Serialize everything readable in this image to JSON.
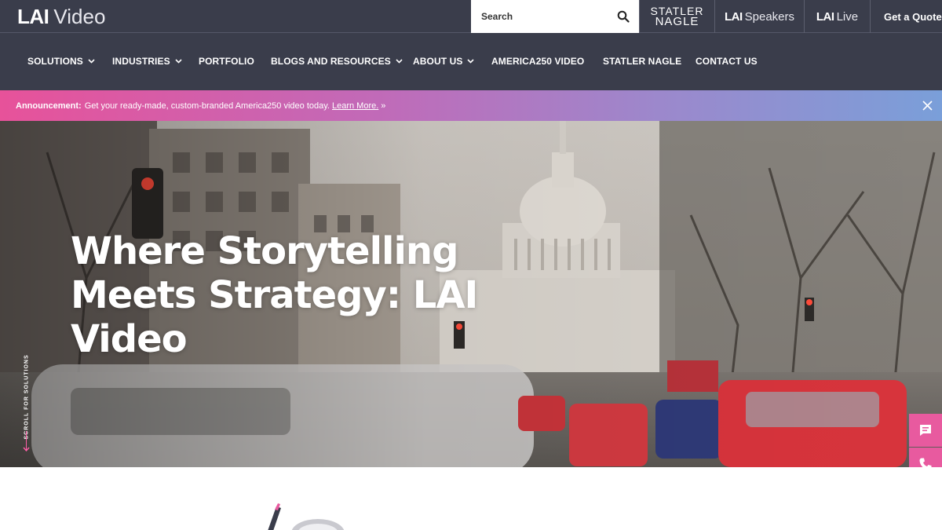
{
  "brand": {
    "logo_bold": "LAI",
    "logo_light": "Video"
  },
  "search": {
    "placeholder": "Search"
  },
  "utility_links": {
    "statler_line1": "STATLER",
    "statler_line2": "NAGLE",
    "speakers_bold": "LAI",
    "speakers_light": "Speakers",
    "live_bold": "LAI",
    "live_light": "Live",
    "quote": "Get a Quote"
  },
  "nav": {
    "items": [
      {
        "label": "SOLUTIONS",
        "has_dropdown": true
      },
      {
        "label": "INDUSTRIES",
        "has_dropdown": true
      },
      {
        "label": "PORTFOLIO",
        "has_dropdown": false
      },
      {
        "label": "BLOGS AND RESOURCES",
        "has_dropdown": true
      },
      {
        "label": "ABOUT US",
        "has_dropdown": true
      },
      {
        "label": "AMERICA250 VIDEO",
        "has_dropdown": false
      },
      {
        "label": "STATLER NAGLE",
        "has_dropdown": false
      },
      {
        "label": "CONTACT US",
        "has_dropdown": false
      }
    ]
  },
  "announcement": {
    "label": "Announcement:",
    "text": "Get your ready-made, custom-branded America250 video today.",
    "link": "Learn More.",
    "arrow": "»"
  },
  "hero": {
    "title": "Where Storytelling Meets Strategy: LAI Video",
    "scroll_label": "SCROLL FOR SOLUTIONS"
  },
  "side_actions": {
    "icons": [
      "chat-icon",
      "phone-icon",
      "mail-icon"
    ]
  },
  "colors": {
    "nav_bg": "#3a3d4b",
    "accent_pink": "#e85a9f",
    "announce_gradient_start": "#e7529a",
    "announce_gradient_end": "#7a9fd9"
  }
}
